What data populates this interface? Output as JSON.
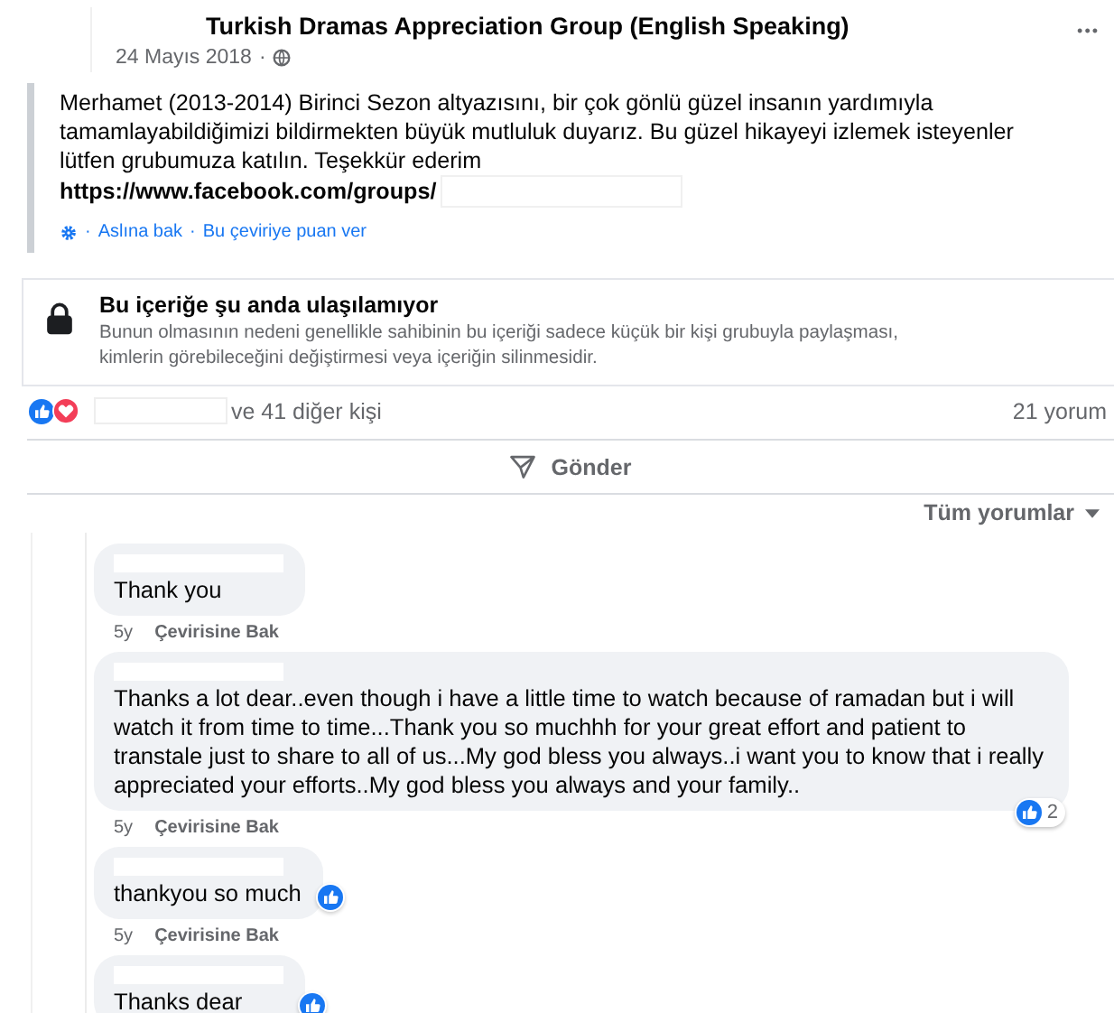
{
  "post": {
    "group": "Turkish Dramas Appreciation Group (English Speaking)",
    "date": "24 Mayıs 2018",
    "separator": "·",
    "more": "•••",
    "text": "Merhamet (2013-2014) Birinci Sezon altyazısını, bir çok gönlü güzel insanın yardımıyla tamamlayabildiğimizi bildirmekten büyük mutluluk duyarız. Bu güzel hikayeyi izlemek isteyenler lütfen grubumuza katılın. Teşekkür ederim",
    "link": "https://www.facebook.com/groups/",
    "translation": {
      "separator": "·",
      "see_original": "Aslına bak",
      "rate": "Bu çeviriye puan ver"
    }
  },
  "unavailable": {
    "title": "Bu içeriğe şu anda ulaşılamıyor",
    "description": "Bunun olmasının nedeni genellikle sahibinin bu içeriği sadece küçük bir kişi grubuyla paylaşması, kimlerin görebileceğini değiştirmesi veya içeriğin silinmesidir."
  },
  "reactions": {
    "others": "ve 41 diğer kişi",
    "comments": "21 yorum"
  },
  "send": "Gönder",
  "sort": "Tüm yorumlar",
  "comments": [
    {
      "text": "Thank you",
      "time": "5y",
      "translate": "Çevirisine Bak",
      "liked": false
    },
    {
      "text": "Thanks a lot dear..even though i have a little time to watch because of ramadan but i will watch it from time to time...Thank you so muchhh for your great effort and patient to transtale just to share to all of us...My god bless you always..i want you to know that i really appreciated your efforts..My god bless you always and your family..",
      "time": "5y",
      "translate": "Çevirisine Bak",
      "liked": true,
      "like_count": "2"
    },
    {
      "text": "thankyou so much",
      "time": "5y",
      "translate": "Çevirisine Bak",
      "liked": true
    },
    {
      "text": "Thanks dear",
      "liked": true
    }
  ]
}
